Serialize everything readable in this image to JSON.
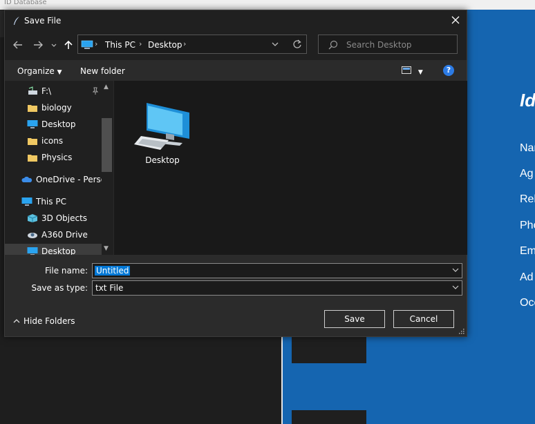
{
  "background_app": {
    "title": "ID Database",
    "heading": "Id",
    "fields": [
      "Nar",
      "Ag",
      "Rel",
      "Pho",
      "Em",
      "Ad",
      "Occ"
    ]
  },
  "dialog": {
    "title": "Save File",
    "address": {
      "crumbs": [
        "This PC",
        "Desktop"
      ]
    },
    "search_placeholder": "Search Desktop",
    "toolbar": {
      "organize": "Organize",
      "new_folder": "New folder",
      "help": "?"
    },
    "nav_items": [
      {
        "label": "F:\\",
        "icon": "drive-icon",
        "pinned": true
      },
      {
        "label": "biology",
        "icon": "folder-icon"
      },
      {
        "label": "Desktop",
        "icon": "desktop-icon"
      },
      {
        "label": "icons",
        "icon": "folder-icon"
      },
      {
        "label": "Physics",
        "icon": "folder-icon"
      },
      {
        "label": "OneDrive - Person",
        "icon": "onedrive-icon"
      },
      {
        "label": "This PC",
        "icon": "computer-icon"
      },
      {
        "label": "3D Objects",
        "icon": "3d-objects-icon"
      },
      {
        "label": "A360 Drive",
        "icon": "a360-drive-icon"
      },
      {
        "label": "Desktop",
        "icon": "desktop-icon",
        "selected": true
      }
    ],
    "files": [
      {
        "label": "Desktop",
        "icon": "desktop-computer-icon"
      }
    ],
    "file_name_label": "File name:",
    "file_name_value": "Untitled",
    "save_type_label": "Save as type:",
    "save_type_value": "txt File",
    "hide_folders": "Hide Folders",
    "save_button": "Save",
    "cancel_button": "Cancel"
  },
  "colors": {
    "accent": "#0078d7",
    "background_panel": "#1565b0",
    "dialog_bg": "#202020"
  }
}
